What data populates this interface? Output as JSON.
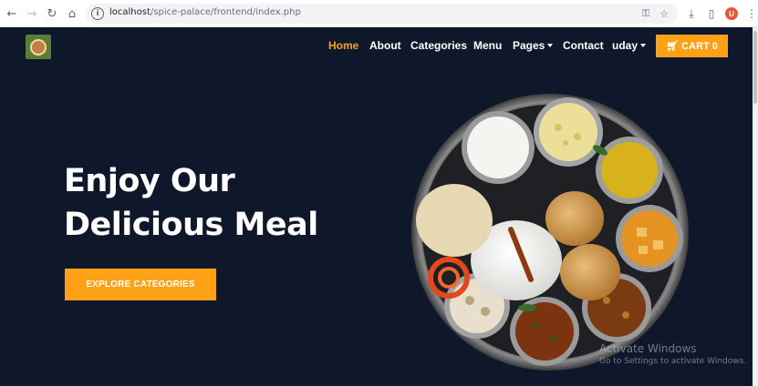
{
  "browser": {
    "url_host": "localhost",
    "url_path": "/spice-palace/frontend/index.php",
    "profile_initial": "U"
  },
  "nav": {
    "items": [
      {
        "label": "Home",
        "active": true
      },
      {
        "label": "About"
      },
      {
        "label": "Categories"
      },
      {
        "label": "Menu"
      },
      {
        "label": "Pages",
        "dropdown": true
      },
      {
        "label": "Contact"
      },
      {
        "label": "uday",
        "dropdown": true
      }
    ],
    "cart_label": "CART 0"
  },
  "hero": {
    "title_line1": "Enjoy Our",
    "title_line2": "Delicious Meal",
    "button_label": "EXPLORE CATEGORIES"
  },
  "watermark": {
    "title": "Activate Windows",
    "subtitle": "Go to Settings to activate Windows."
  },
  "colors": {
    "accent": "#fea116",
    "background": "#0f172b"
  }
}
